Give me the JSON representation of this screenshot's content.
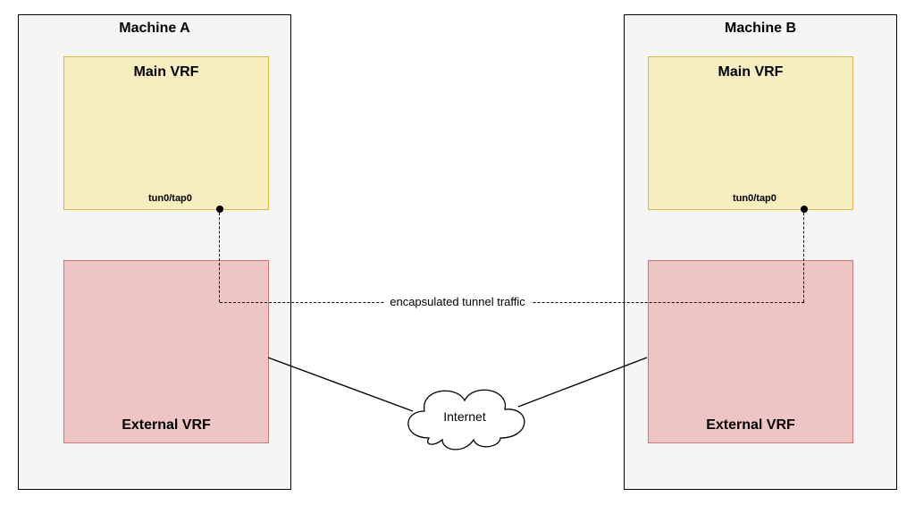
{
  "machineA": {
    "title": "Machine A",
    "mainVrf": {
      "title": "Main VRF",
      "tunLabel": "tun0/tap0"
    },
    "externalVrf": {
      "title": "External VRF"
    }
  },
  "machineB": {
    "title": "Machine B",
    "mainVrf": {
      "title": "Main VRF",
      "tunLabel": "tun0/tap0"
    },
    "externalVrf": {
      "title": "External VRF"
    }
  },
  "centerLabel": "encapsulated tunnel traffic",
  "cloudLabel": "Internet"
}
